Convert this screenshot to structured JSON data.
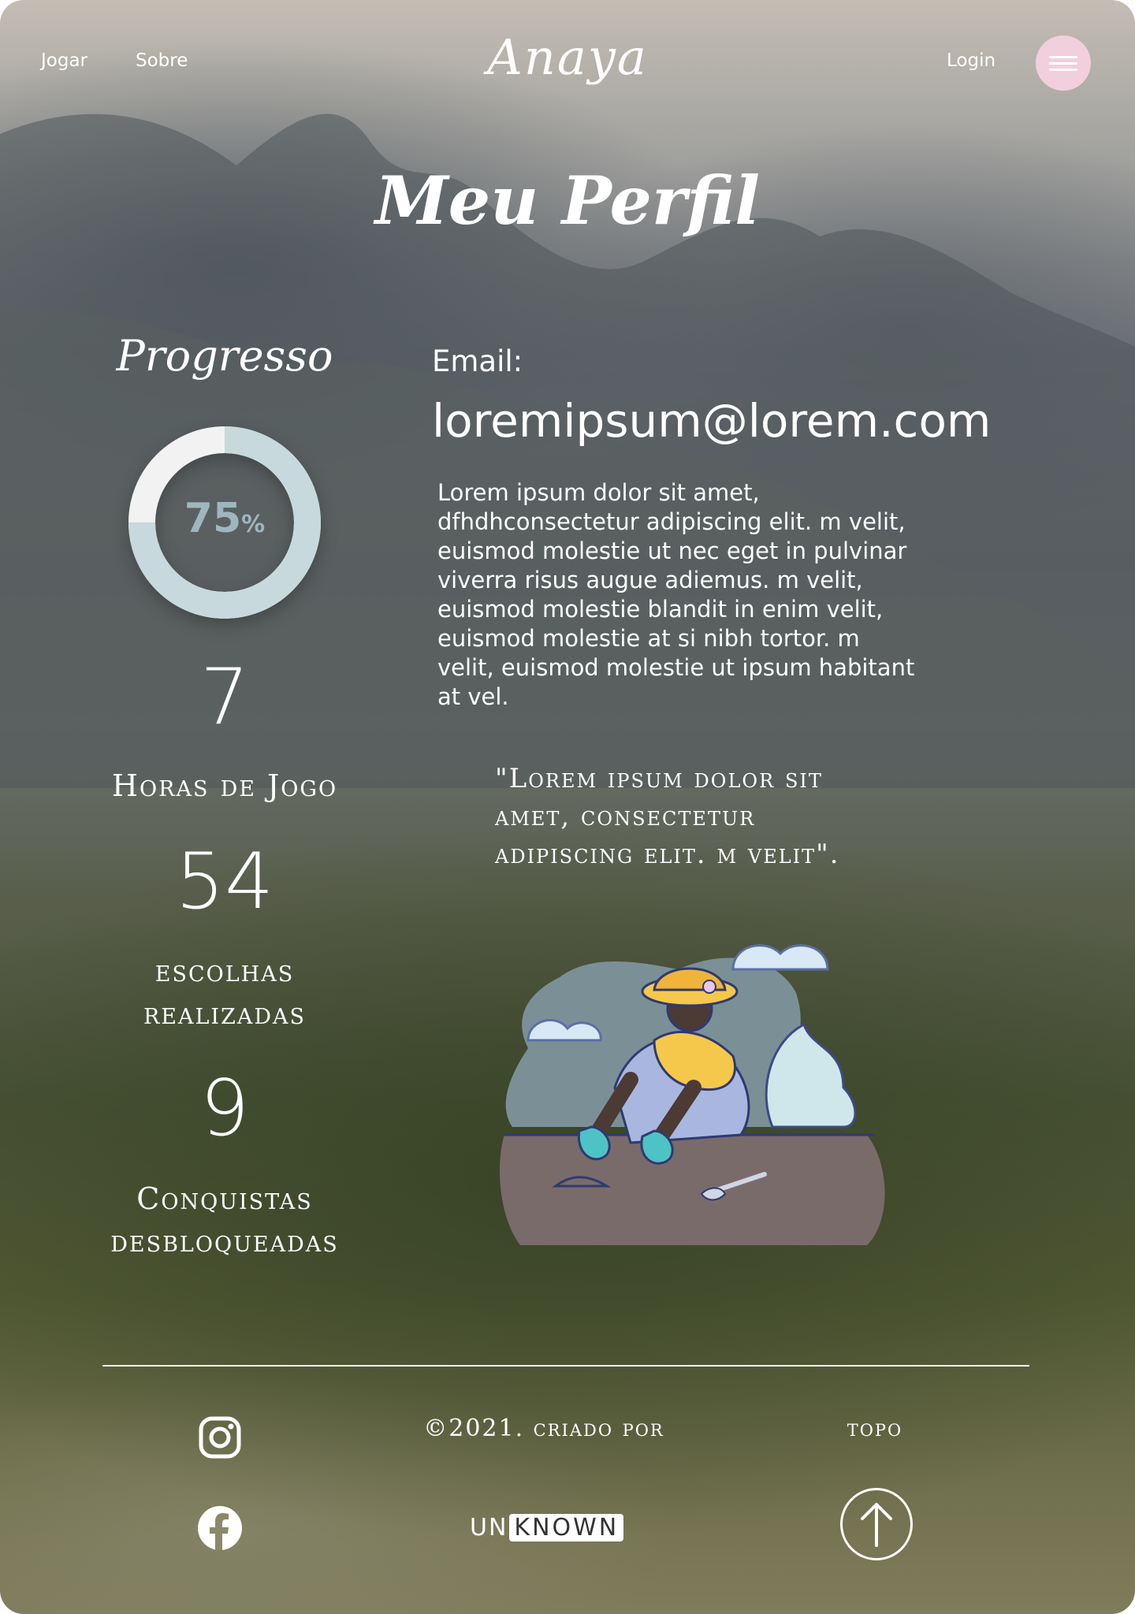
{
  "header": {
    "nav": [
      "Jogar",
      "Sobre"
    ],
    "brand": "Anaya",
    "login": "Login",
    "menu_icon": "hamburger-menu-icon"
  },
  "page_title": "Meu Perfil",
  "progress": {
    "title": "Progresso",
    "percent_value": "75",
    "percent_sign": "%",
    "fraction": 0.75,
    "colors": {
      "track": "#f2f2f2",
      "fill": "#c7d9dc",
      "text": "#9fb6bd"
    }
  },
  "stats": [
    {
      "value": "7",
      "caption": "Horas de Jogo"
    },
    {
      "value": "54",
      "caption_lines": [
        "escolhas",
        "realizadas"
      ]
    },
    {
      "value": "9",
      "caption_lines": [
        "Conquistas",
        "desbloqueadas"
      ]
    }
  ],
  "profile": {
    "email_label": "Email:",
    "email_value": "loremipsum@lorem.com",
    "bio_lines": [
      "Lorem ipsum dolor sit amet,",
      "dfhdhconsectetur adipiscing elit. m velit,",
      "euismod molestie ut nec eget in pulvinar",
      "viverra risus augue adiemus. m velit,",
      "euismod molestie blandit in enim velit,",
      "euismod molestie at si  nibh tortor. m",
      "velit, euismod molestie ut ipsum habitant",
      "at vel."
    ],
    "quote_lines": [
      "\"Lorem ipsum dolor sit",
      " amet, consectetur",
      " adipiscing elit. m velit\"."
    ]
  },
  "footer": {
    "copyright": "©2021. criado por",
    "unknown_prefix": "UN",
    "unknown_box": "KNOWN",
    "topo": "topo",
    "icons": [
      "instagram-icon",
      "facebook-icon",
      "arrow-up-icon"
    ]
  }
}
